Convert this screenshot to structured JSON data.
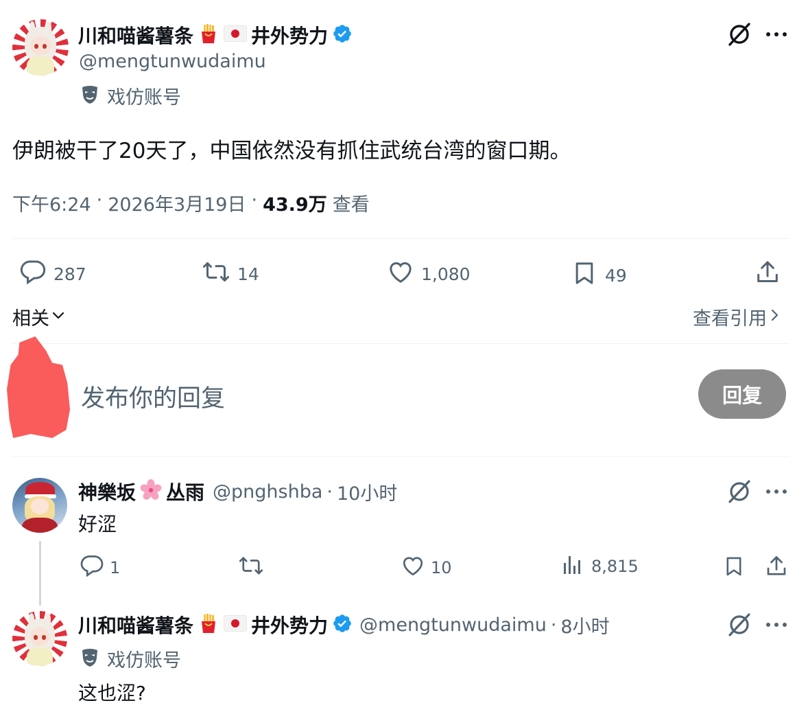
{
  "main_tweet": {
    "display_name": "川和喵酱薯条",
    "display_name_suffix": "井外势力",
    "handle": "@mengtunwudaimu",
    "parody_label": "戏仿账号",
    "text": "伊朗被干了20天了，中国依然没有抓住武统台湾的窗口期。",
    "time": "下午6:24",
    "date": "2026年3月19日",
    "views_count": "43.9万",
    "views_label": "查看",
    "stats": {
      "replies": "287",
      "retweets": "14",
      "likes": "1,080",
      "bookmarks": "49"
    }
  },
  "related": {
    "label": "相关",
    "view_quotes": "查看引用"
  },
  "composer": {
    "placeholder": "发布你的回复",
    "reply_button": "回复"
  },
  "replies": [
    {
      "display_name": "神樂坂",
      "display_name_suffix": "丛雨",
      "handle": "@pnghshba",
      "time": "10小时",
      "text": "好涩",
      "stats": {
        "replies": "1",
        "retweets": "",
        "likes": "10",
        "views": "8,815"
      }
    },
    {
      "display_name": "川和喵酱薯条",
      "display_name_suffix": "井外势力",
      "handle": "@mengtunwudaimu",
      "time": "8小时",
      "parody_label": "戏仿账号",
      "text": "这也涩?"
    }
  ],
  "separator": "·",
  "icons": {
    "fries": "fries-icon",
    "japan_flag": "japan-flag-icon",
    "verified": "verified-badge-icon",
    "parody_mask": "parody-mask-icon",
    "grok": "grok-icon",
    "more": "more-icon",
    "reply": "reply-icon",
    "retweet": "retweet-icon",
    "like": "like-icon",
    "bookmark": "bookmark-icon",
    "share": "share-icon",
    "views": "views-icon",
    "cherry_blossom": "cherry-blossom-icon",
    "chevron_down": "chevron-down-icon",
    "chevron_right": "chevron-right-icon"
  },
  "colors": {
    "verified_blue": "#1d9bf0",
    "muted_text": "#536471",
    "reply_button_bg": "#8b8b8b",
    "redaction": "#fa5b5b"
  }
}
